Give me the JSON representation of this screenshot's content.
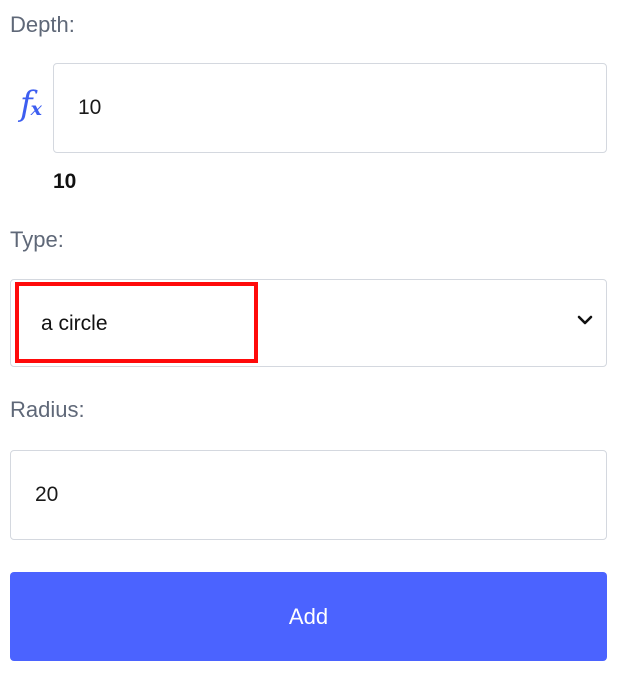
{
  "form": {
    "depth": {
      "label": "Depth:",
      "formula_icon": "fx-icon",
      "input_value": "10",
      "computed_value": "10"
    },
    "type": {
      "label": "Type:",
      "selected_value": "a circle",
      "dropdown_icon": "chevron-down-icon"
    },
    "radius": {
      "label": "Radius:",
      "input_value": "20"
    },
    "add_button_label": "Add"
  },
  "colors": {
    "label_text": "#5f6878",
    "accent": "#4b63ff",
    "formula_icon": "#3d5ef0",
    "highlight_border": "#ff0a0a",
    "field_border": "#d4d8df"
  }
}
